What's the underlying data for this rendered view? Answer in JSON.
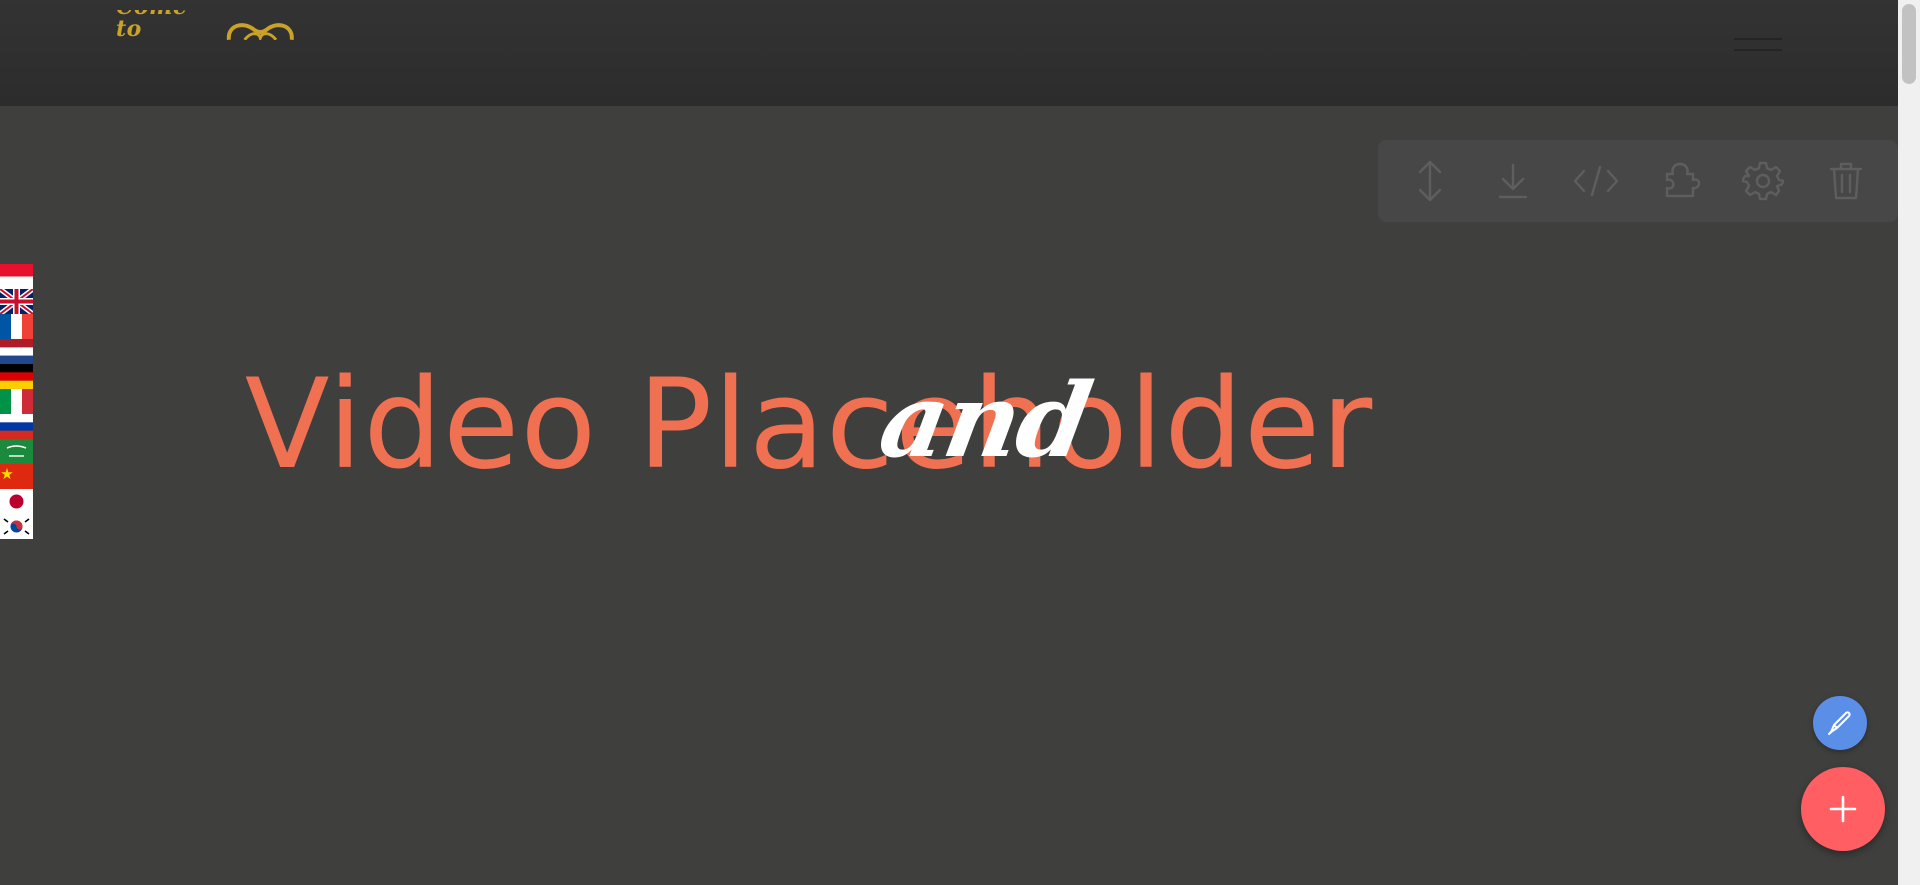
{
  "header": {
    "logo_text": "Come to",
    "menu_toggle_icon": "hamburger-icon"
  },
  "toolbar": {
    "buttons": [
      {
        "name": "move",
        "icon": "vertical-arrows-icon"
      },
      {
        "name": "download",
        "icon": "download-icon"
      },
      {
        "name": "code",
        "icon": "code-icon"
      },
      {
        "name": "plugin",
        "icon": "puzzle-icon"
      },
      {
        "name": "settings",
        "icon": "gear-icon"
      },
      {
        "name": "delete",
        "icon": "trash-icon"
      }
    ]
  },
  "languages": [
    {
      "code": "id",
      "icon": "flag-indonesia-icon"
    },
    {
      "code": "en",
      "icon": "flag-uk-icon"
    },
    {
      "code": "fr",
      "icon": "flag-france-icon"
    },
    {
      "code": "nl",
      "icon": "flag-netherlands-icon"
    },
    {
      "code": "de",
      "icon": "flag-germany-icon"
    },
    {
      "code": "it",
      "icon": "flag-italy-icon"
    },
    {
      "code": "ru",
      "icon": "flag-russia-icon"
    },
    {
      "code": "ar",
      "icon": "flag-saudi-arabia-icon"
    },
    {
      "code": "zh",
      "icon": "flag-china-icon"
    },
    {
      "code": "ja",
      "icon": "flag-japan-icon"
    },
    {
      "code": "ko",
      "icon": "flag-korea-icon"
    }
  ],
  "main": {
    "headline": "Video Placeholder",
    "headline_overlay": "and"
  },
  "fabs": {
    "edit_icon": "pen-icon",
    "add_icon": "plus-icon"
  },
  "colors": {
    "background": "#3f3f3e",
    "header": "#2e2e2e",
    "headline": "#f07052",
    "logo": "#c9a227",
    "edit_fab": "#5b8ee6",
    "add_fab": "#ff5e62"
  }
}
